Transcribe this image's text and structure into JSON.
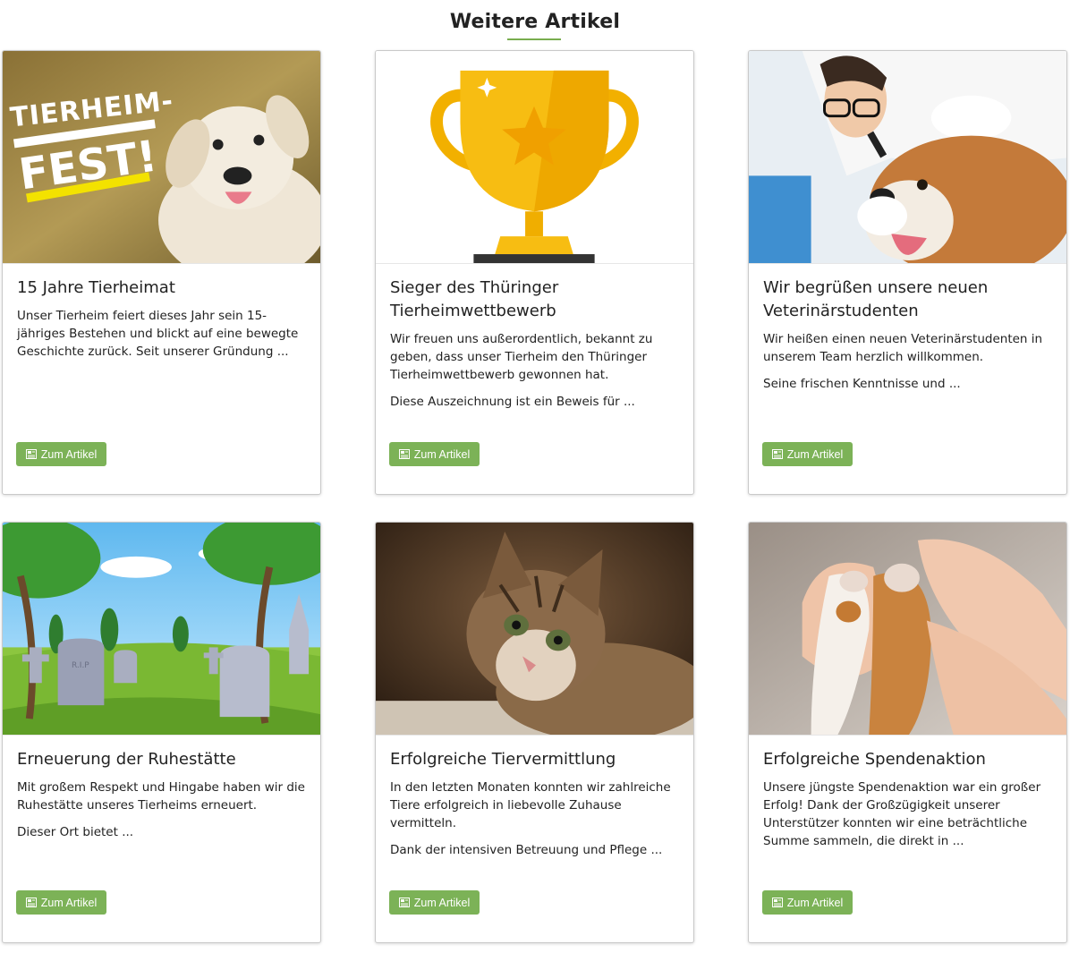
{
  "section": {
    "title": "Weitere Artikel"
  },
  "button_label": "Zum Artikel",
  "colors": {
    "accent": "#7cb257",
    "underline": "#79ad4f"
  },
  "cards": [
    {
      "title": "15 Jahre Tierheimat",
      "paragraphs": [
        "Unser Tierheim feiert dieses Jahr sein 15-jähriges Bestehen und blickt auf eine bewegte Geschichte zurück. Seit unserer Gründung ..."
      ],
      "image": {
        "kind": "puppy-fest-banner",
        "text_line1": "TIERHEIM-",
        "text_line2": "FEST!"
      }
    },
    {
      "title": "Sieger des Thüringer Tierheimwettbewerb",
      "paragraphs": [
        "Wir freuen uns außerordentlich, bekannt zu geben, dass unser Tierheim den Thüringer Tierheimwettbewerb gewonnen hat.",
        "Diese Auszeichnung ist ein Beweis für ..."
      ],
      "image": {
        "kind": "golden-trophy"
      }
    },
    {
      "title": "Wir begrüßen unsere neuen Veterinärstudenten",
      "paragraphs": [
        "Wir heißen einen neuen Veterinärstudenten in unserem Team herzlich willkommen.",
        "Seine frischen Kenntnisse und ..."
      ],
      "image": {
        "kind": "vet-examining-dog"
      }
    },
    {
      "title": "Erneuerung der Ruhestätte",
      "paragraphs": [
        "Mit großem Respekt und Hingabe haben wir die Ruhestätte unseres Tierheims erneuert.",
        "Dieser Ort bietet ..."
      ],
      "image": {
        "kind": "cemetery-illustration",
        "tomb_text": "R.I.P"
      }
    },
    {
      "title": "Erfolgreiche Tiervermittlung",
      "paragraphs": [
        "In den letzten Monaten konnten wir zahlreiche Tiere erfolgreich in liebevolle Zuhause vermitteln.",
        "Dank der intensiven Betreuung und Pflege ..."
      ],
      "image": {
        "kind": "tabby-cat"
      }
    },
    {
      "title": "Erfolgreiche Spendenaktion",
      "paragraphs": [
        "Unsere jüngste Spendenaktion war ein großer Erfolg! Dank der Großzügigkeit unserer Unterstützer konnten wir eine beträchtliche Summe sammeln, die direkt in ..."
      ],
      "image": {
        "kind": "dog-paws-in-hands"
      }
    }
  ]
}
